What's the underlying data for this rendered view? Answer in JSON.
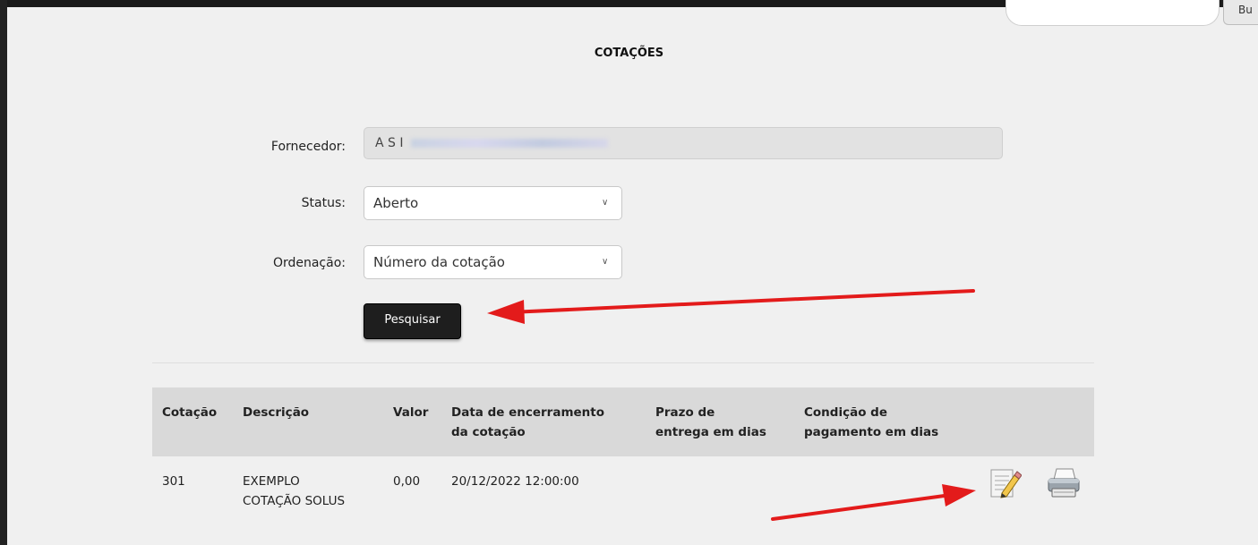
{
  "header": {
    "search_button_label": "Bu",
    "search_placeholder": ""
  },
  "page": {
    "title": "COTAÇÕES"
  },
  "form": {
    "supplier": {
      "label": "Fornecedor:",
      "value_visible": "A S I"
    },
    "status": {
      "label": "Status:",
      "selected": "Aberto"
    },
    "ordering": {
      "label": "Ordenação:",
      "selected": "Número da cotação"
    },
    "search_button": "Pesquisar"
  },
  "table": {
    "headers": [
      {
        "line1": "Cotação",
        "line2": ""
      },
      {
        "line1": "Descrição",
        "line2": ""
      },
      {
        "line1": "Valor",
        "line2": ""
      },
      {
        "line1": "Data de encerramento",
        "line2": "da cotação"
      },
      {
        "line1": "Prazo de",
        "line2": "entrega em dias"
      },
      {
        "line1": "Condição de",
        "line2": "pagamento em dias"
      }
    ],
    "rows": [
      {
        "number": "301",
        "description_line1": "EXEMPLO",
        "description_line2": "COTAÇÃO SOLUS",
        "value": "0,00",
        "closing_date": "20/12/2022 12:00:00",
        "delivery_days": "",
        "payment_days": ""
      }
    ]
  },
  "icons": {
    "edit": "edit-note-icon",
    "print": "printer-icon"
  },
  "colors": {
    "annotation_arrow": "#e31b1b",
    "button_dark": "#1e1e1e",
    "header_bg": "#d9d9d9"
  }
}
